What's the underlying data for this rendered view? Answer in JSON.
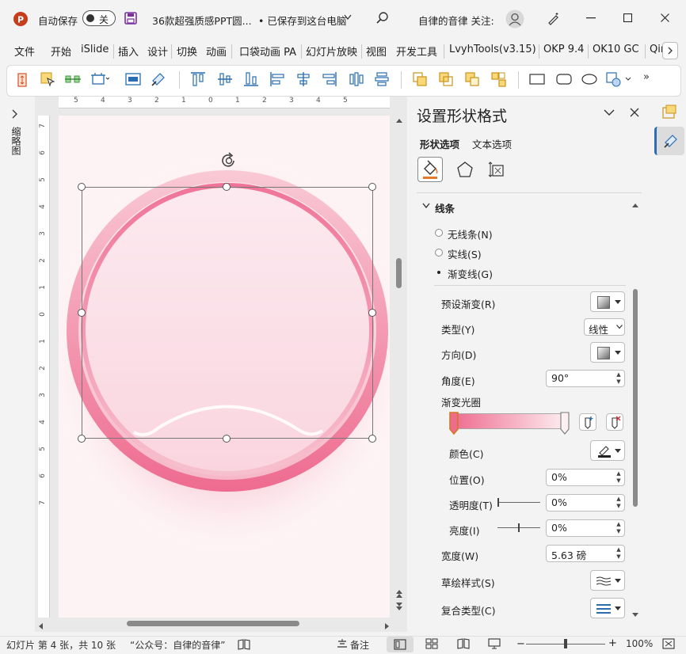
{
  "titlebar": {
    "autosave_label": "自动保存",
    "autosave_state": "关",
    "doc_title": "36款超强质感PPT圆...",
    "save_status": "• 已保存到这台电脑",
    "user_label": "自律的音律 关注:"
  },
  "menu": [
    {
      "label": "文件"
    },
    {
      "label": "开始"
    },
    {
      "label": "iSlide"
    },
    {
      "label": "插入"
    },
    {
      "label": "设计"
    },
    {
      "label": "切换"
    },
    {
      "label": "动画"
    },
    {
      "label": "口袋动画 PA"
    },
    {
      "label": "幻灯片放映"
    },
    {
      "label": "视图"
    },
    {
      "label": "开发工具"
    },
    {
      "label": "LvyhTools(v3.15)"
    },
    {
      "label": "OKP 9.4"
    },
    {
      "label": "OK10 GC"
    },
    {
      "label": "Qin"
    }
  ],
  "left_strip": {
    "label": "缩略图"
  },
  "ruler": {
    "h_ticks": [
      "5",
      "4",
      "3",
      "2",
      "1",
      "0",
      "1",
      "2",
      "3",
      "4",
      "5"
    ],
    "v_ticks": [
      "7",
      "6",
      "5",
      "4",
      "3",
      "2",
      "1",
      "0",
      "1",
      "2",
      "3",
      "4",
      "5",
      "6",
      "7"
    ]
  },
  "pane": {
    "title": "设置形状格式",
    "tab_shape": "形状选项",
    "tab_text": "文本选项",
    "section": "线条",
    "radio_none": "无线条(N)",
    "radio_solid": "实线(S)",
    "radio_gradient": "渐变线(G)",
    "preset_label": "预设渐变(R)",
    "type_label": "类型(Y)",
    "type_value": "线性",
    "direction_label": "方向(D)",
    "angle_label": "角度(E)",
    "angle_value": "90°",
    "stops_label": "渐变光圈",
    "color_label": "颜色(C)",
    "position_label": "位置(O)",
    "position_value": "0%",
    "transparency_label": "透明度(T)",
    "transparency_value": "0%",
    "transparency_level": 0,
    "brightness_label": "亮度(I)",
    "brightness_value": "0%",
    "brightness_level": 0.5,
    "width_label": "宽度(W)",
    "width_value": "5.63 磅",
    "sketch_label": "草绘样式(S)",
    "compound_label": "复合类型(C)"
  },
  "status": {
    "slide_info": "幻灯片 第 4 张，共 10 张",
    "author_note": "“公众号：自律的音律”",
    "notes": "备注",
    "zoom": "100%"
  },
  "colors": {
    "accent": "#ef6b8e",
    "ring_light": "#f7c3d0",
    "pane_bg": "#f3f3f3",
    "title_icon": "#c43e1c"
  }
}
